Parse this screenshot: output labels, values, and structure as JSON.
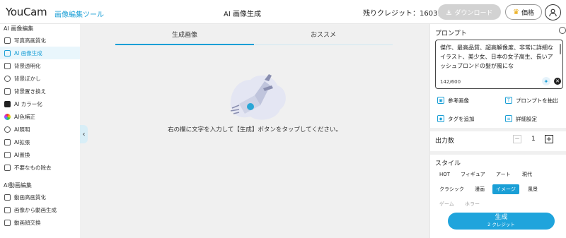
{
  "header": {
    "logo": "YouCam",
    "logo_sub": "画像編集ツール",
    "title": "AI 画像生成",
    "credits": "残りクレジット：16031",
    "download_label": "ダウンロード",
    "price_label": "価格"
  },
  "sidebar": {
    "section1": "AI 画像編集",
    "items1": [
      {
        "label": "写真高画質化",
        "icon": "enhance-icon"
      },
      {
        "label": "AI 画像生成",
        "icon": "ai-generate-icon",
        "active": true
      },
      {
        "label": "背景透明化",
        "icon": "transparent-bg-icon"
      },
      {
        "label": "背景ぼかし",
        "icon": "blur-bg-icon"
      },
      {
        "label": "背景置き換え",
        "icon": "replace-bg-icon"
      },
      {
        "label": "AI カラー化",
        "icon": "colorize-icon"
      },
      {
        "label": "AI色補正",
        "icon": "color-correct-icon"
      },
      {
        "label": "AI照明",
        "icon": "light-icon"
      },
      {
        "label": "AI拡張",
        "icon": "expand-icon"
      },
      {
        "label": "AI置換",
        "icon": "replace-icon"
      },
      {
        "label": "不要なもの除去",
        "icon": "remove-object-icon"
      }
    ],
    "section2": "AI動画編集",
    "items2": [
      {
        "label": "動画高画質化",
        "icon": "video-enhance-icon"
      },
      {
        "label": "画像から動画生成",
        "icon": "image-to-video-icon"
      },
      {
        "label": "動画顔交換",
        "icon": "face-swap-icon"
      }
    ]
  },
  "main": {
    "tabs": [
      {
        "label": "生成画像"
      },
      {
        "label": "おススメ"
      }
    ],
    "hint": "右の欄に文字を入力して【生成】ボタンをタップしてください。"
  },
  "panel": {
    "prompt_label": "プロンプト",
    "prompt_text": "傑作、最高品質、超高解像度、非常に詳細なイラスト、美少女、日本の女子高生、長いアッシュブロンドの髪が風にな",
    "prompt_count": "142/600",
    "ref_image": "参考画像",
    "extract_prompt": "プロンプトを抽出",
    "add_tag": "タグを追加",
    "advanced": "詳細設定",
    "output_label": "出力数",
    "output_value": "1",
    "style_label": "スタイル",
    "styles": [
      "HOT",
      "フィギュア",
      "アート",
      "現代",
      "クラシック",
      "漫画",
      "イメージ",
      "風景",
      "ゲーム",
      "ホラー"
    ],
    "selected_style": "イメージ",
    "generate": "生成",
    "generate_cost": "2 クレジット"
  },
  "colors": {
    "accent": "#1a9fd6",
    "main_bg": "#f0f0f0"
  }
}
